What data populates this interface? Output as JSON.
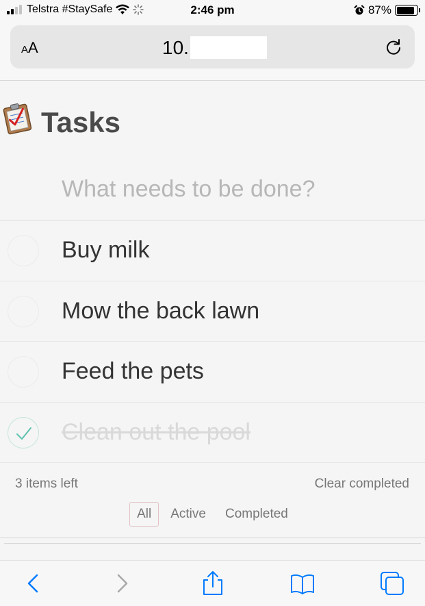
{
  "status_bar": {
    "carrier": "Telstra #StaySafe",
    "time": "2:46 pm",
    "battery_percent": "87%",
    "battery_level": 0.87
  },
  "address_bar": {
    "text_size_label_small": "A",
    "text_size_label_large": "A",
    "url": "10."
  },
  "app": {
    "title": "Tasks",
    "new_todo_placeholder": "What needs to be done?",
    "todos": [
      {
        "label": "Buy milk",
        "completed": false
      },
      {
        "label": "Mow the back lawn",
        "completed": false
      },
      {
        "label": "Feed the pets",
        "completed": false
      },
      {
        "label": "Clean out the pool",
        "completed": true
      }
    ],
    "footer": {
      "items_left": "3 items left",
      "clear_completed": "Clear completed",
      "filters": [
        "All",
        "Active",
        "Completed"
      ],
      "selected_filter": "All"
    }
  },
  "colors": {
    "accent": "#007aff",
    "check": "#5dc2af",
    "filter_border": "#e3c2c6"
  },
  "icons": {
    "status": [
      "signal-icon",
      "wifi-icon",
      "loading-icon",
      "alarm-icon",
      "battery-icon"
    ],
    "toolbar": [
      "back-icon",
      "forward-icon",
      "share-icon",
      "bookmarks-icon",
      "tabs-icon"
    ]
  }
}
